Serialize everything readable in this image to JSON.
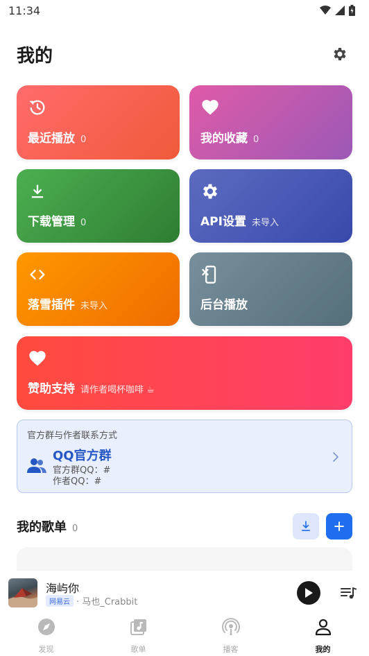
{
  "status_bar": {
    "time": "11:34"
  },
  "header": {
    "title": "我的"
  },
  "cards": {
    "recent": {
      "label": "最近播放",
      "sub": "0"
    },
    "favorites": {
      "label": "我的收藏",
      "sub": "0"
    },
    "downloads": {
      "label": "下载管理",
      "sub": "0"
    },
    "api": {
      "label": "API设置",
      "sub": "未导入"
    },
    "plugin": {
      "label": "落雪插件",
      "sub": "未导入"
    },
    "background": {
      "label": "后台播放",
      "sub": ""
    },
    "sponsor": {
      "label": "赞助支持",
      "sub": "请作者喝杯咖啡 ☕"
    }
  },
  "contact": {
    "title": "官方群与作者联系方式",
    "qq_title": "QQ官方群",
    "group_line": "官方群QQ：#",
    "author_line": "作者QQ：#"
  },
  "playlists": {
    "title": "我的歌单",
    "count": "0"
  },
  "player": {
    "song": "海屿你",
    "source": "网易云",
    "artist": "· 马也_Crabbit"
  },
  "nav": {
    "discover": "发现",
    "songlist": "歌单",
    "podcast": "播客",
    "mine": "我的"
  },
  "colors": {
    "accent": "#1f6ef0",
    "qq_blue": "#2456c4"
  }
}
